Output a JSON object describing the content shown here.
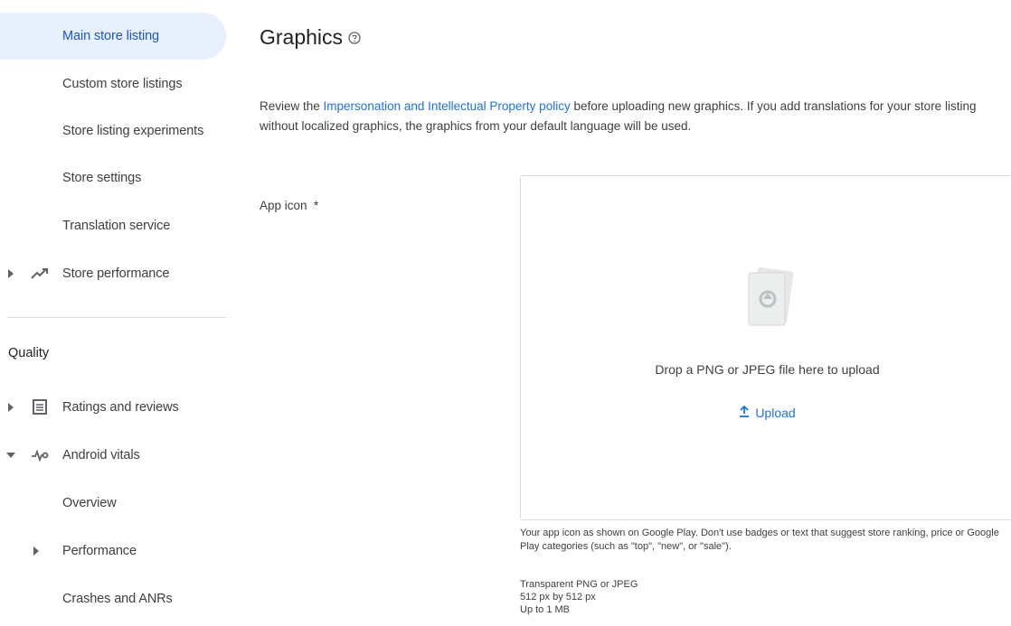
{
  "sidebar": {
    "items": [
      {
        "label": "Main store listing"
      },
      {
        "label": "Custom store listings"
      },
      {
        "label": "Store listing experiments"
      },
      {
        "label": "Store settings"
      },
      {
        "label": "Translation service"
      },
      {
        "label": "Store performance",
        "icon": "trending-up-icon"
      }
    ],
    "section_title": "Quality",
    "quality_items": [
      {
        "label": "Ratings and reviews",
        "icon": "reviews-icon"
      },
      {
        "label": "Android vitals",
        "icon": "vitals-icon"
      },
      {
        "label": "Overview"
      },
      {
        "label": "Performance"
      },
      {
        "label": "Crashes and ANRs"
      }
    ]
  },
  "main": {
    "title": "Graphics",
    "desc_prefix": "Review the ",
    "desc_link": "Impersonation and Intellectual Property policy",
    "desc_suffix": " before uploading new graphics. If you add translations for your store listing without localized graphics, the graphics from your default language will be used.",
    "app_icon_label": "App icon  *",
    "drop_text": "Drop a PNG or JPEG file here to upload",
    "upload_label": "Upload",
    "hint": "Your app icon as shown on Google Play. Don't use badges or text that suggest store ranking, price or Google Play categories (such as \"top\", \"new\", or \"sale\").",
    "specs": [
      "Transparent PNG or JPEG",
      "512 px by 512 px",
      "Up to 1 MB"
    ]
  },
  "colors": {
    "accent": "#1a73e8",
    "active_bg": "#e8f0fe"
  }
}
